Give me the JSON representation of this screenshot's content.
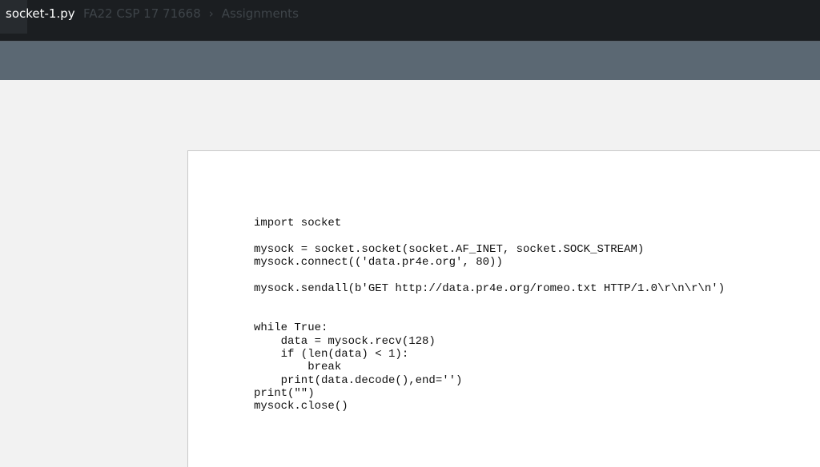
{
  "header": {
    "file_name": "socket-1.py",
    "background_course": "FA22 CSP 17 71668",
    "background_separator": "›",
    "background_section": "Assignments"
  },
  "document": {
    "code_lines": [
      "import socket",
      "",
      "mysock = socket.socket(socket.AF_INET, socket.SOCK_STREAM)",
      "mysock.connect(('data.pr4e.org', 80))",
      "",
      "mysock.sendall(b'GET http://data.pr4e.org/romeo.txt HTTP/1.0\\r\\n\\r\\n')",
      "",
      "",
      "while True:",
      "    data = mysock.recv(128)",
      "    if (len(data) < 1):",
      "        break",
      "    print(data.decode(),end='')",
      "print(\"\")",
      "mysock.close()"
    ]
  }
}
